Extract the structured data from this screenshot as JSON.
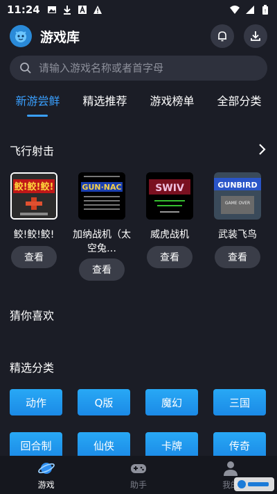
{
  "status_bar": {
    "time": "11:24",
    "left_icons": [
      "image-icon",
      "download-icon",
      "font-icon",
      "warning-icon"
    ],
    "right_icons": [
      "wifi-icon",
      "signal-icon",
      "battery-icon"
    ]
  },
  "header": {
    "title": "游戏库",
    "actions": [
      "bell-icon",
      "download-icon"
    ]
  },
  "search": {
    "placeholder": "请输入游戏名称或者首字母"
  },
  "tabs": [
    {
      "label": "新游尝鲜",
      "active": true
    },
    {
      "label": "精选推荐",
      "active": false
    },
    {
      "label": "游戏榜单",
      "active": false
    },
    {
      "label": "全部分类",
      "active": false
    }
  ],
  "section_shooting": {
    "title": "飞行射击"
  },
  "games": [
    {
      "name": "鲛!鲛!鲛!",
      "view_label": "查看"
    },
    {
      "name": "加纳战机（太空兔…",
      "view_label": "查看"
    },
    {
      "name": "威虎战机",
      "view_label": "查看"
    },
    {
      "name": "武装飞鸟",
      "view_label": "查看"
    }
  ],
  "section_guess": {
    "title": "猜你喜欢"
  },
  "section_categories": {
    "title": "精选分类"
  },
  "categories": [
    "动作",
    "Q版",
    "魔幻",
    "三国",
    "回合制",
    "仙侠",
    "卡牌",
    "传奇"
  ],
  "bottom_nav": [
    {
      "label": "游戏",
      "icon": "planet-icon",
      "active": true
    },
    {
      "label": "助手",
      "icon": "gamepad-icon",
      "active": false
    },
    {
      "label": "我的",
      "icon": "user-icon",
      "active": false
    }
  ],
  "colors": {
    "background": "#1b1d26",
    "accent": "#3aa0ff",
    "category_button": "#1b8ae6"
  }
}
